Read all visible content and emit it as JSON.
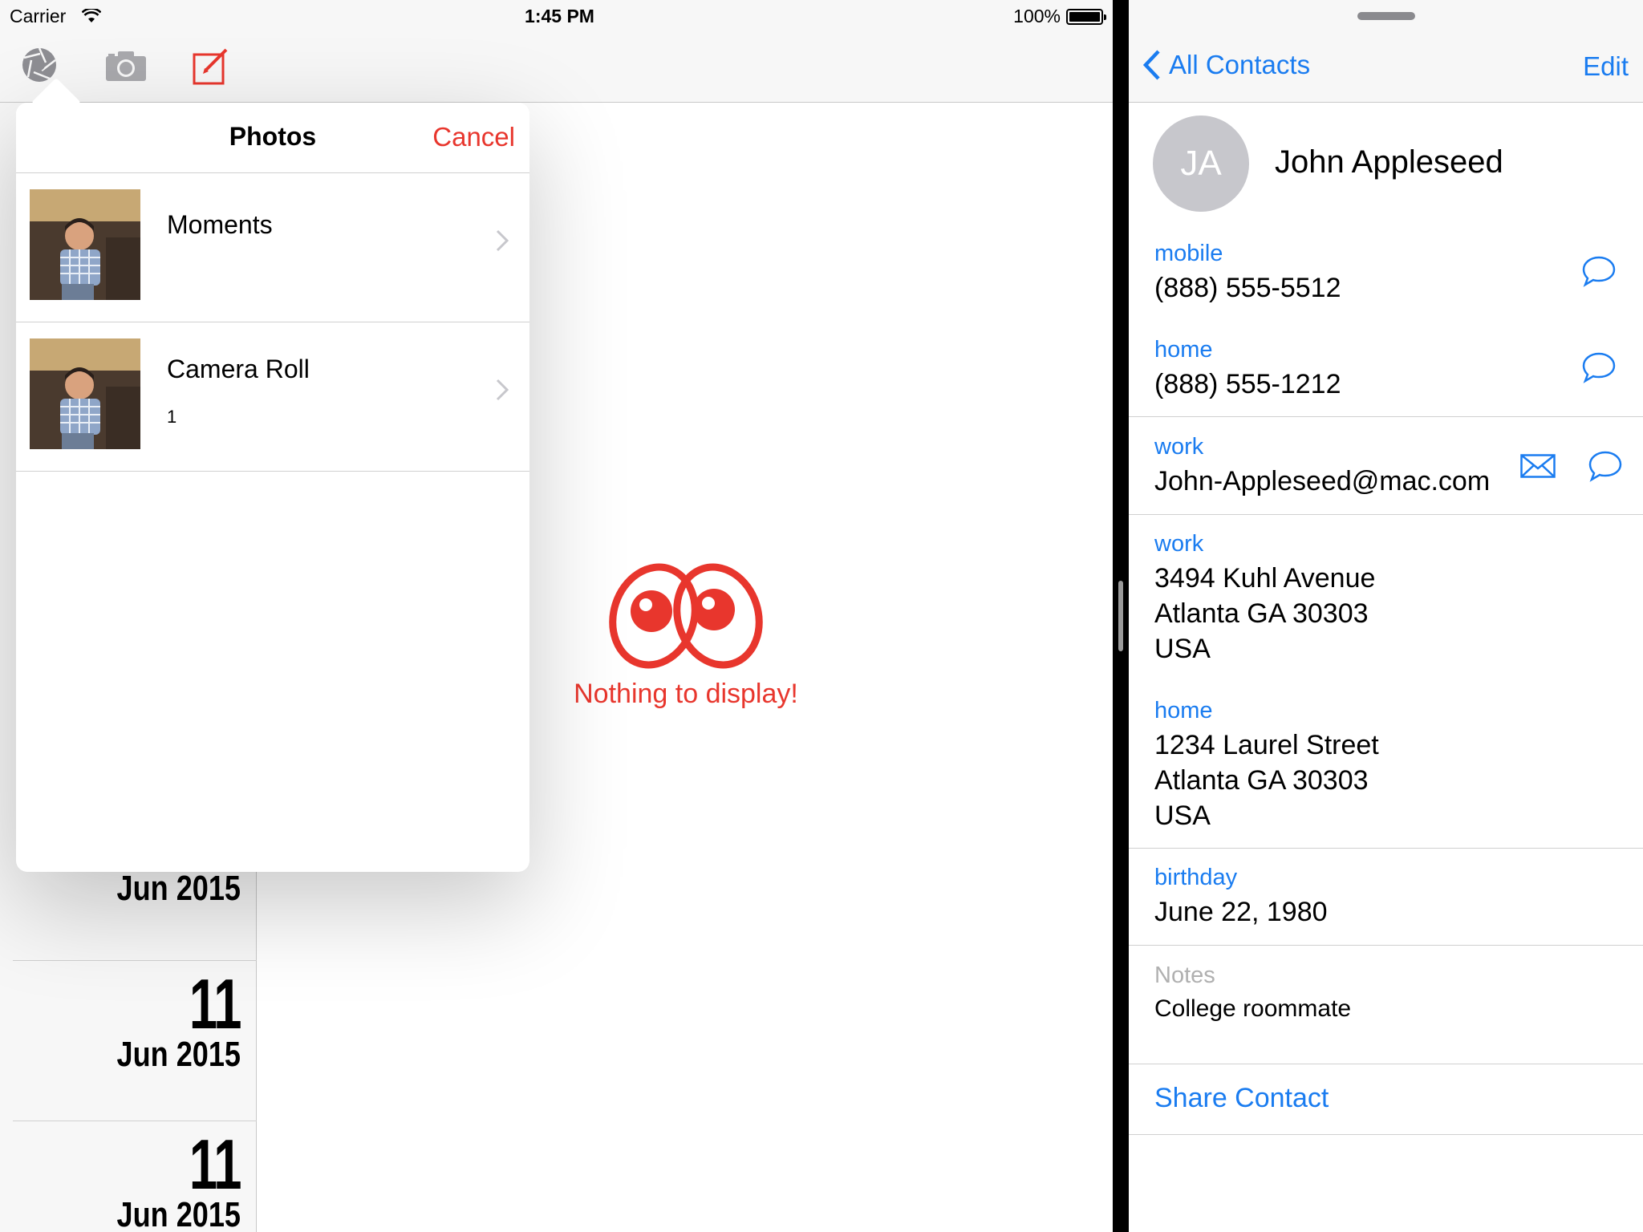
{
  "status_bar": {
    "carrier": "Carrier",
    "time": "1:45 PM",
    "battery": "100%"
  },
  "toolbar": {
    "icons": [
      "aperture-icon",
      "camera-icon",
      "compose-icon"
    ],
    "accent": "#e8362d"
  },
  "dates": [
    {
      "day": "",
      "month_year": "Jun 2015"
    },
    {
      "day": "11",
      "month_year": "Jun 2015"
    },
    {
      "day": "11",
      "month_year": "Jun 2015"
    }
  ],
  "empty_state": {
    "message": "Nothing to display!",
    "icon": "eyes-icon"
  },
  "photos_popover": {
    "title": "Photos",
    "cancel": "Cancel",
    "albums": [
      {
        "name": "Moments",
        "count": ""
      },
      {
        "name": "Camera Roll",
        "count": "1"
      }
    ]
  },
  "contact": {
    "nav": {
      "back": "All Contacts",
      "edit": "Edit"
    },
    "initials": "JA",
    "name": "John Appleseed",
    "phones": [
      {
        "label": "mobile",
        "value": "(888) 555-5512"
      },
      {
        "label": "home",
        "value": "(888) 555-1212"
      }
    ],
    "email": {
      "label": "work",
      "value": "John-Appleseed@mac.com"
    },
    "addresses": [
      {
        "label": "work",
        "lines": [
          "3494 Kuhl Avenue",
          "Atlanta GA 30303",
          "USA"
        ]
      },
      {
        "label": "home",
        "lines": [
          "1234 Laurel Street",
          "Atlanta GA 30303",
          "USA"
        ]
      }
    ],
    "birthday": {
      "label": "birthday",
      "value": "June 22, 1980"
    },
    "notes": {
      "label": "Notes",
      "value": "College roommate"
    },
    "share": "Share Contact",
    "tint": "#1a7cf0"
  }
}
